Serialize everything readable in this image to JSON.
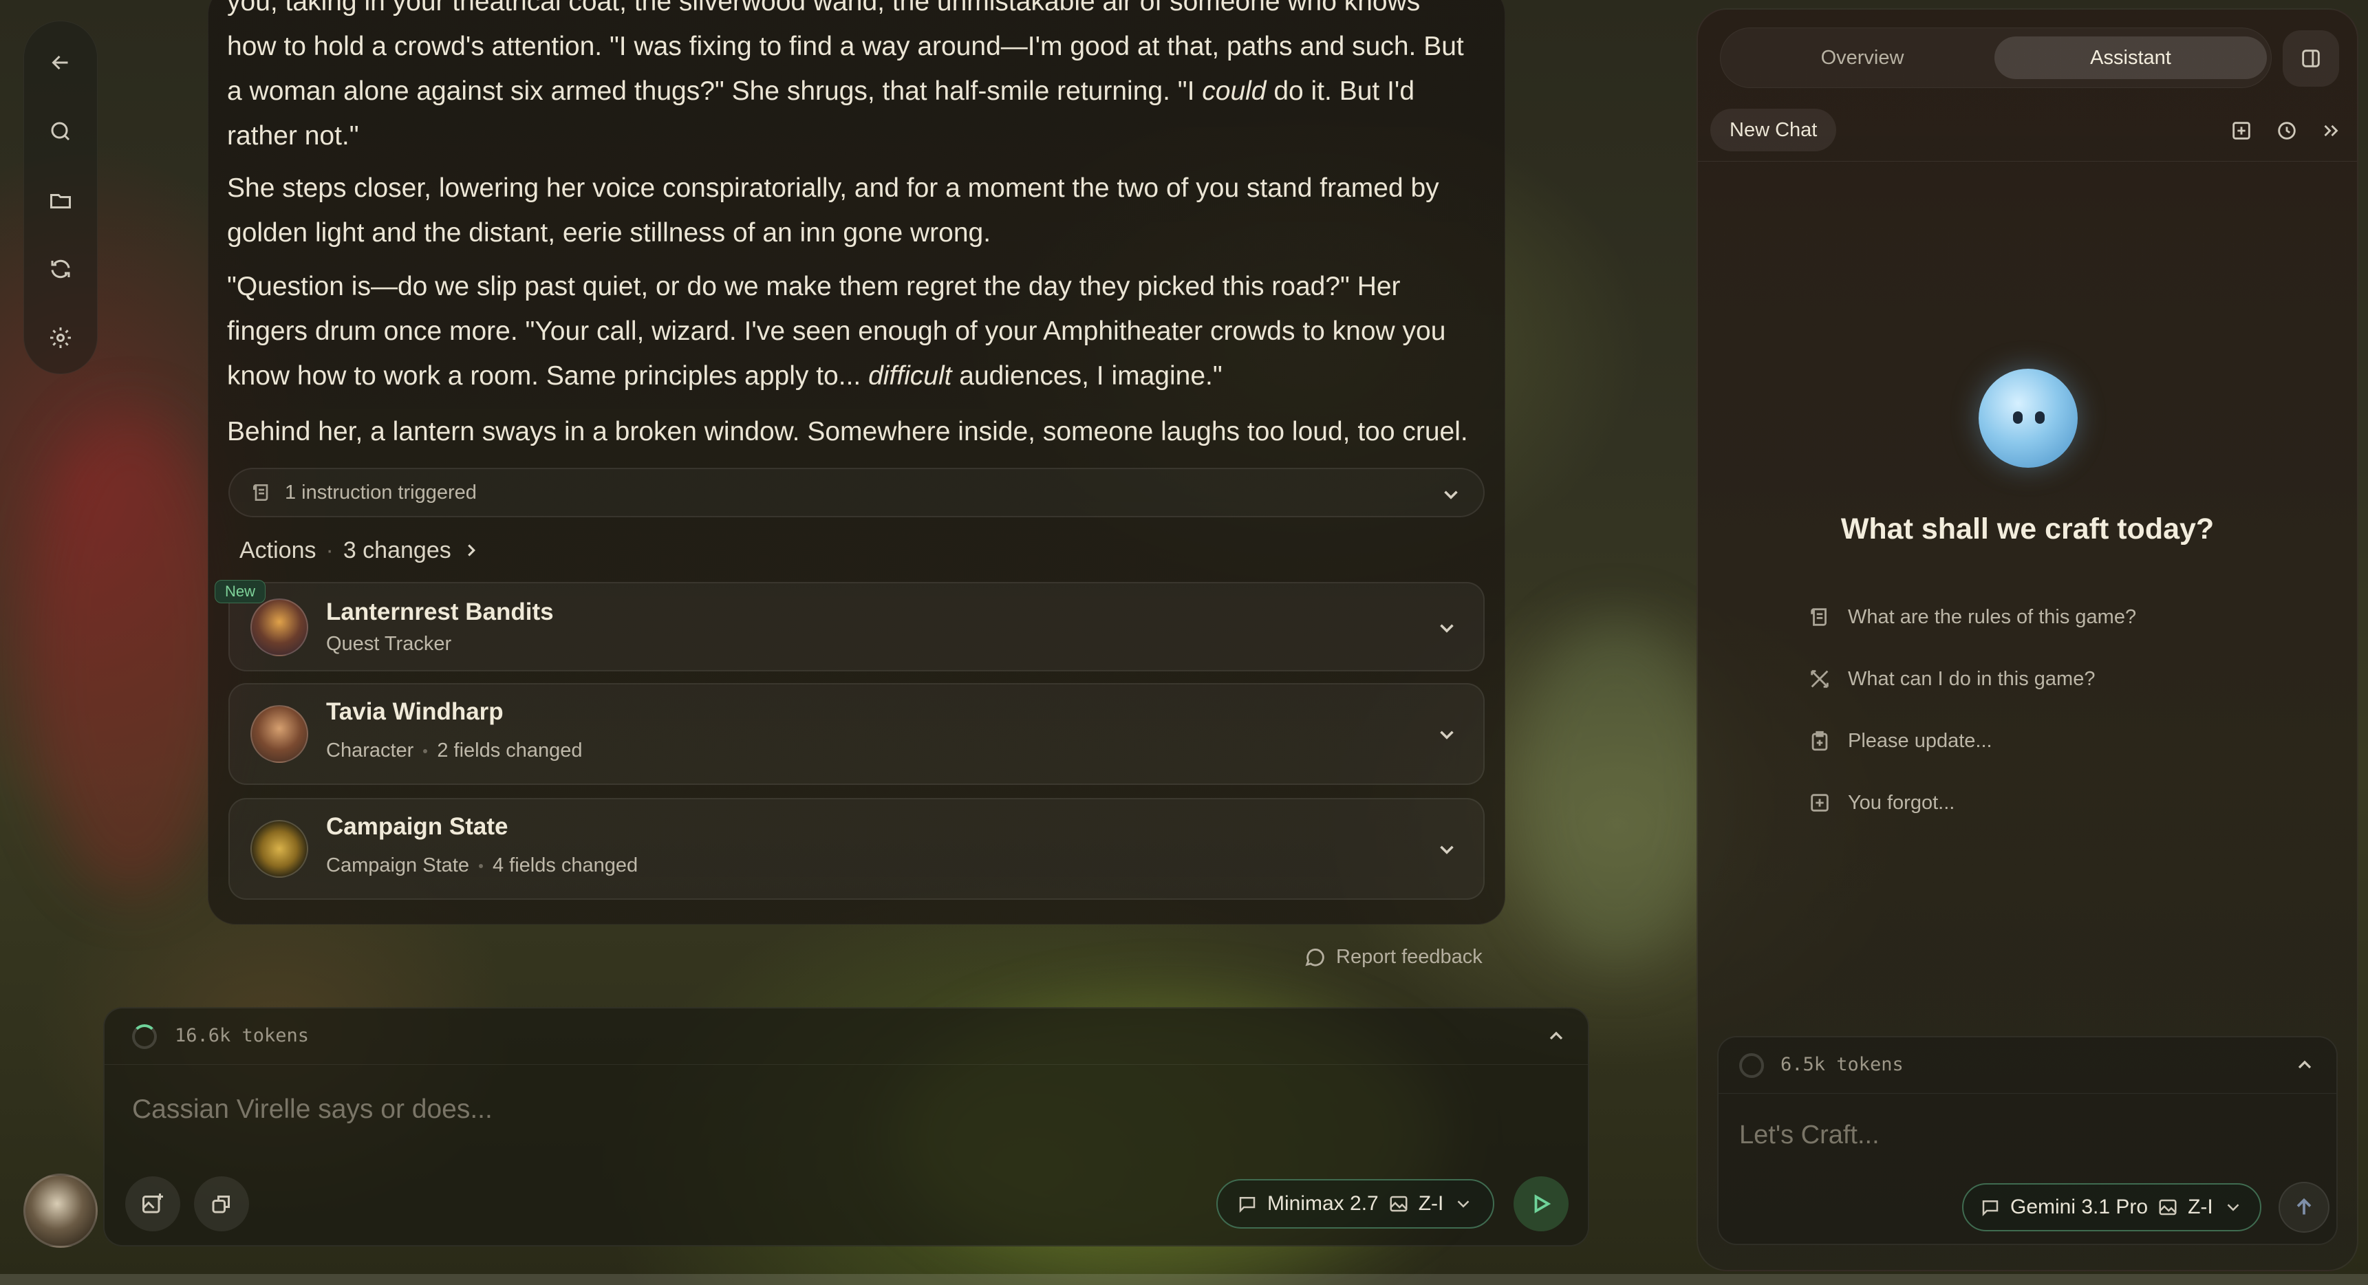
{
  "nav": {
    "back": "back-arrow",
    "items": [
      "search",
      "folder",
      "refresh",
      "settings"
    ]
  },
  "story": {
    "para1_line0": "you, taking in your theatrical coat, the silverwood wand, the unmistakable air of someone who knows",
    "para1_line1": "how to hold a crowd's attention. \"I was fixing to find a way around—I'm good at that, paths and such. But",
    "para1_line2": "a woman alone against six armed thugs?\" She shrugs, that half-smile returning. \"I ",
    "para1_em": "could",
    "para1_line2b": " do it. But I'd",
    "para1_line3": "rather not.\"",
    "para2": "She steps closer, lowering her voice conspiratorially, and for a moment the two of you stand framed by golden light and the distant, eerie stillness of an inn gone wrong.",
    "para3_a": "\"Question is—do we slip past quiet, or do we make them regret the day they picked this road?\" Her fingers drum once more. \"Your call, wizard. I've seen enough of your Amphitheater crowds to know you know how to work a room. Same principles apply to... ",
    "para3_em": "difficult",
    "para3_b": " audiences, I imagine.\"",
    "para4": "Behind her, a lantern sways in a broken window. Somewhere inside, someone laughs too loud, too cruel."
  },
  "instruction_bar": {
    "label": "1  instruction triggered"
  },
  "actions": {
    "label": "Actions",
    "changes": "3 changes"
  },
  "changes": [
    {
      "badge": "New",
      "title": "Lanternrest Bandits",
      "type": "Quest Tracker",
      "fields": ""
    },
    {
      "badge": "",
      "title": "Tavia Windharp",
      "type": "Character",
      "fields": "2 fields changed"
    },
    {
      "badge": "",
      "title": "Campaign State",
      "type": "Campaign State",
      "fields": "4 fields changed"
    }
  ],
  "feedback": {
    "label": "Report feedback"
  },
  "composer": {
    "tokens": "16.6k tokens",
    "placeholder": "Cassian Virelle says or does...",
    "model": "Minimax 2.7",
    "image_model": "Z-I"
  },
  "assistant": {
    "tabs": [
      "Overview",
      "Assistant"
    ],
    "active_tab": "Assistant",
    "chat_tab": "New Chat",
    "title": "What shall we craft today?",
    "suggestions": [
      "What are the rules of this game?",
      "What can I do in this game?",
      "Please update...",
      "You forgot..."
    ],
    "tokens": "6.5k tokens",
    "placeholder": "Let's Craft...",
    "model": "Gemini 3.1 Pro",
    "image_model": "Z-I"
  },
  "colors": {
    "accent_green": "#3f6b50",
    "send_green": "#6fd39a",
    "badge_green": "#7fd39a",
    "mascot_blue": "#8cc8ec"
  }
}
